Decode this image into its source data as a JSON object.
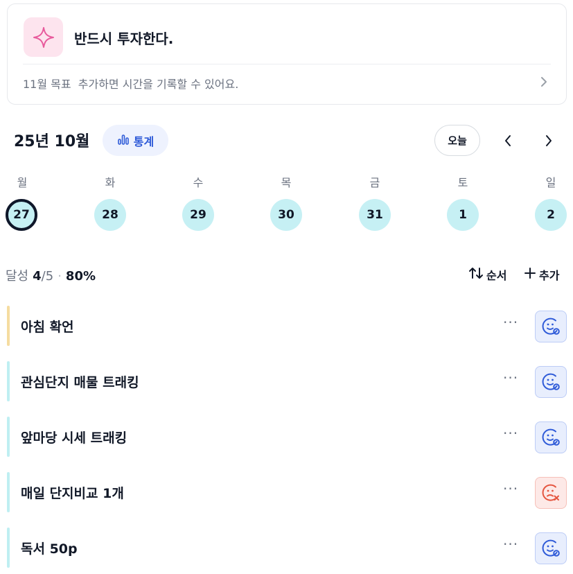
{
  "goal": {
    "title": "반드시 투자한다.",
    "subtitle": "11월 목표  추가하면 시간을 기록할 수 있어요.",
    "icon": "sparkle-icon",
    "chevron_icon": "chevron-right-icon"
  },
  "calendar": {
    "month_label": "25년 10월",
    "stats_label": "통계",
    "today_label": "오늘",
    "weekdays": [
      "월",
      "화",
      "수",
      "목",
      "금",
      "토",
      "일"
    ],
    "dates": [
      "27",
      "28",
      "29",
      "30",
      "31",
      "1",
      "2"
    ],
    "selected_index": 0
  },
  "progress": {
    "label": "달성",
    "done": "4",
    "total": "/5",
    "percent": "80%"
  },
  "toolbar": {
    "sort_label": "순서",
    "add_label": "추가"
  },
  "tasks": [
    {
      "label": "아침 확언",
      "status": "done"
    },
    {
      "label": "관심단지 매물 트래킹",
      "status": "done"
    },
    {
      "label": "앞마당 시세 트래킹",
      "status": "done"
    },
    {
      "label": "매일 단지비교 1개",
      "status": "fail"
    },
    {
      "label": "독서 50p",
      "status": "done"
    }
  ],
  "more_label": "···",
  "colors": {
    "accent_blue": "#2f5bd8",
    "day_circle": "#c6f0f4",
    "task_bar_first": "#f5dca0",
    "task_bar": "#bfeff2",
    "fail_red": "#e5553f"
  }
}
